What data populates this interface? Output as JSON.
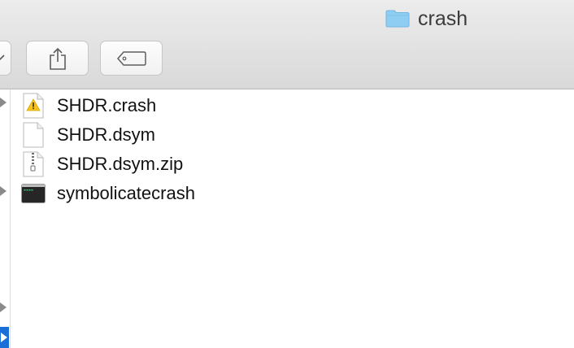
{
  "window": {
    "title": "crash",
    "title_icon": "folder-icon"
  },
  "toolbar": {
    "buttons": [
      {
        "name": "action-dropdown",
        "icon": "chevron-down-icon"
      },
      {
        "name": "share",
        "icon": "share-icon"
      },
      {
        "name": "tags",
        "icon": "tag-icon"
      }
    ]
  },
  "files": [
    {
      "name": "SHDR.crash",
      "icon": "warning-document-icon"
    },
    {
      "name": "SHDR.dsym",
      "icon": "blank-document-icon"
    },
    {
      "name": "SHDR.dsym.zip",
      "icon": "zip-archive-icon"
    },
    {
      "name": "symbolicatecrash",
      "icon": "terminal-executable-icon"
    }
  ],
  "colors": {
    "folder": "#8fcdf2",
    "selection": "#1a6ed8",
    "warning": "#f5c422"
  }
}
